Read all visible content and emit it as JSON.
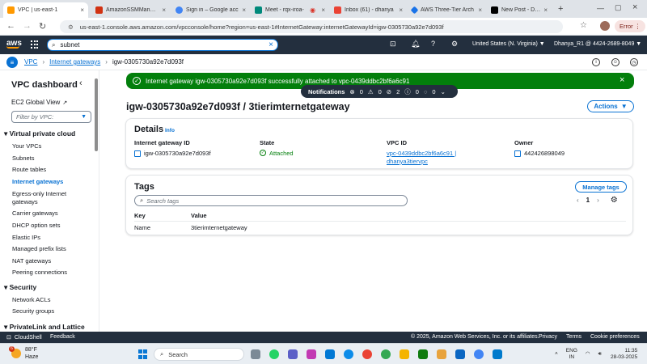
{
  "browser": {
    "tabs": [
      {
        "label": "VPC | us-east-1",
        "color": "#ff9900"
      },
      {
        "label": "AmazonSSMManage",
        "color": "#d13212"
      },
      {
        "label": "Sign in – Google acc",
        "color": "#4285f4"
      },
      {
        "label": "Meet - rqx-iroa-",
        "color": "#00897b"
      },
      {
        "label": "Inbox (61) - dhanya",
        "color": "#ea4335"
      },
      {
        "label": "AWS Three-Tier Arch",
        "color": "#1a73e8"
      },
      {
        "label": "New Post - DEV Com",
        "color": "#000000"
      }
    ],
    "new_tab": "+",
    "url": "us-east-1.console.aws.amazon.com/vpcconsole/home?region=us-east-1#InternetGateway:internetGatewayId=igw-0305730a92e7d093f",
    "error_label": "Error"
  },
  "aws_nav": {
    "logo": "aws",
    "search_value": "subnet",
    "region": "United States (N. Virginia) ▼",
    "account": "Dhanya_R1 @ 4424-2689-8049 ▼"
  },
  "breadcrumb": {
    "items": [
      "VPC",
      "Internet gateways",
      "igw-0305730a92e7d093f"
    ]
  },
  "sidebar": {
    "title": "VPC dashboard",
    "ec2_link": "EC2 Global View",
    "filter_placeholder": "Filter by VPC:",
    "sections": [
      {
        "label": "Virtual private cloud",
        "items": [
          "Your VPCs",
          "Subnets",
          "Route tables",
          "Internet gateways",
          "Egress-only Internet gateways",
          "Carrier gateways",
          "DHCP option sets",
          "Elastic IPs",
          "Managed prefix lists",
          "NAT gateways",
          "Peering connections"
        ]
      },
      {
        "label": "Security",
        "items": [
          "Network ACLs",
          "Security groups"
        ]
      },
      {
        "label": "PrivateLink and Lattice",
        "items": []
      }
    ]
  },
  "flash": {
    "message": "Internet gateway igw-0305730a92e7d093f successfully attached to vpc-0439ddbc2bf6a6c91",
    "color": "#037f0c"
  },
  "notifications": {
    "label": "Notifications",
    "counts": [
      "0",
      "0",
      "2",
      "0",
      "0"
    ]
  },
  "page": {
    "title": "igw-0305730a92e7d093f / 3tierimternetgateway",
    "actions_label": "Actions"
  },
  "details": {
    "heading": "Details",
    "info": "Info",
    "fields": {
      "igw_label": "Internet gateway ID",
      "igw_value": "igw-0305730a92e7d093f",
      "state_label": "State",
      "state_value": "Attached",
      "vpc_label": "VPC ID",
      "vpc_value_line1": "vpc-0439ddbc2bf6a6c91 |",
      "vpc_value_line2": "dhanya3tiervpc",
      "owner_label": "Owner",
      "owner_value": "442426898049"
    }
  },
  "tags": {
    "heading": "Tags",
    "manage_label": "Manage tags",
    "search_placeholder": "Search tags",
    "page": "1",
    "columns": [
      "Key",
      "Value"
    ],
    "rows": [
      {
        "key": "Name",
        "value": "3tierimternetgateway"
      }
    ]
  },
  "footer": {
    "cloudshell": "CloudShell",
    "feedback": "Feedback",
    "copyright": "© 2025, Amazon Web Services, Inc. or its affiliates.",
    "privacy": "Privacy",
    "terms": "Terms",
    "cookies": "Cookie preferences"
  },
  "taskbar": {
    "weather_temp": "88°F",
    "weather_desc": "Haze",
    "weather_badge": "6",
    "search_label": "Search",
    "lang_line1": "ENG",
    "lang_line2": "IN",
    "time": "11:35",
    "date": "28-03-2025"
  },
  "colors": {
    "aws_dark": "#232f3e",
    "link_blue": "#0972d3",
    "success_green": "#037f0c",
    "aws_orange": "#ff9900"
  }
}
